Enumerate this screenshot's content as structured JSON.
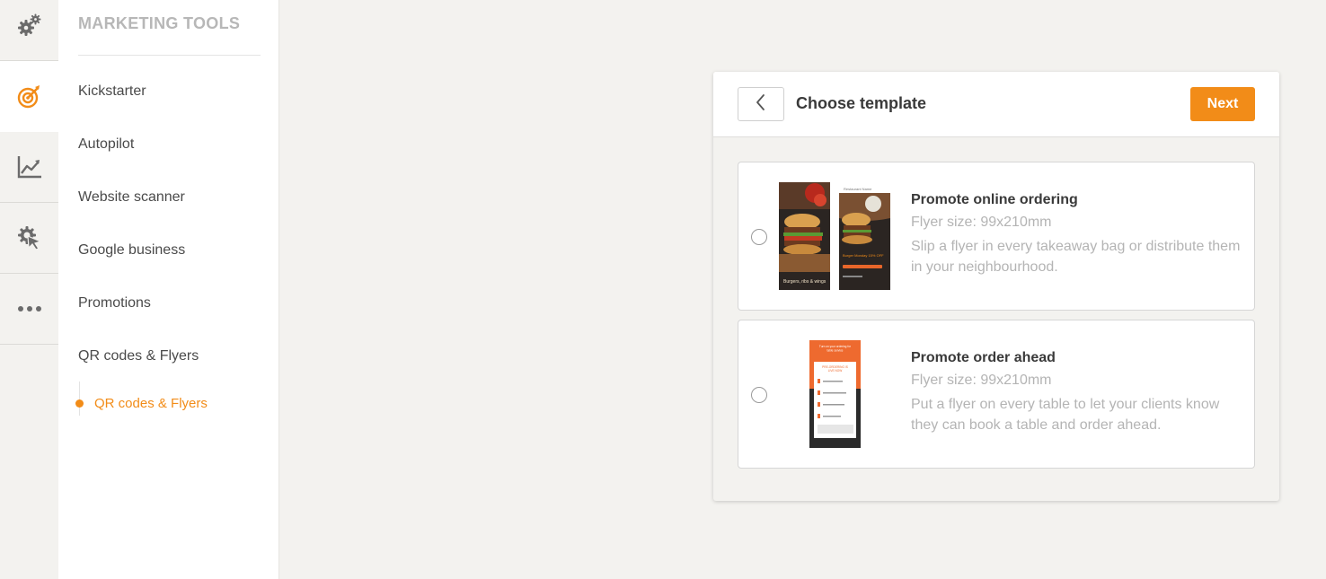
{
  "rail": {
    "items": [
      {
        "icon": "gears-icon"
      },
      {
        "icon": "target-icon",
        "active": true
      },
      {
        "icon": "chart-icon"
      },
      {
        "icon": "cursor-gear-icon"
      },
      {
        "icon": "more-icon"
      }
    ]
  },
  "sidebar": {
    "title": "MARKETING TOOLS",
    "items": [
      {
        "label": "Kickstarter"
      },
      {
        "label": "Autopilot"
      },
      {
        "label": "Website scanner"
      },
      {
        "label": "Google business"
      },
      {
        "label": "Promotions"
      },
      {
        "label": "QR codes & Flyers"
      }
    ],
    "subitem": {
      "label": "QR codes & Flyers",
      "active": true
    }
  },
  "dialog": {
    "title": "Choose template",
    "next_label": "Next",
    "options": [
      {
        "title": "Promote online ordering",
        "size": "Flyer size: 99x210mm",
        "description": "Slip a flyer in every takeaway bag or distribute them in your neighbourhood.",
        "thumbnail": {
          "left_caption": "Burgers, ribs & wings",
          "right_caption": "Burger Monday 15% OFF",
          "header_text": "Restaurant Name"
        }
      },
      {
        "title": "Promote order ahead",
        "size": "Flyer size: 99x210mm",
        "description": "Put a flyer on every table to let your clients know they can book a table and order ahead.",
        "thumbnail": {
          "header_text": "Turn on your ordering for table service",
          "card_title": "PRE-ORDERING IS LIVE NOW"
        }
      }
    ]
  },
  "colors": {
    "accent": "#f28c18",
    "background": "#f3f2ef",
    "text_muted": "#b4b4b4",
    "text_dark": "#3a3a3a"
  }
}
